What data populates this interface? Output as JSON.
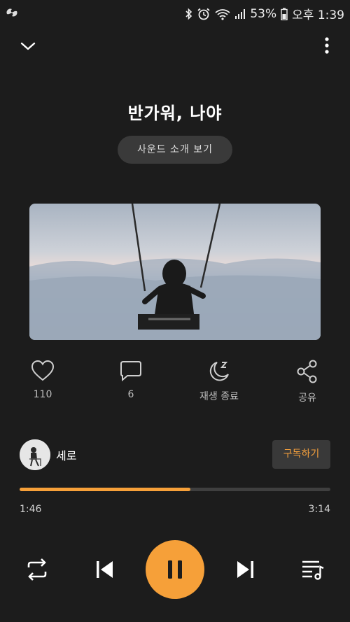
{
  "status": {
    "battery": "53%",
    "time": "오후 1:39"
  },
  "track": {
    "title": "반가워, 나야",
    "intro_label": "사운드 소개 보기"
  },
  "actions": {
    "like_count": "110",
    "comment_count": "6",
    "sleep_label": "재생 종료",
    "share_label": "공유"
  },
  "artist": {
    "name": "세로",
    "subscribe_label": "구독하기"
  },
  "player": {
    "progress_fraction": 0.55,
    "elapsed": "1:46",
    "duration": "3:14"
  },
  "colors": {
    "accent": "#f6a039",
    "background": "#1c1c1c"
  },
  "icons": [
    "chevron-down-icon",
    "more-vertical-icon",
    "heart-icon",
    "comment-icon",
    "moon-sleep-icon",
    "share-icon",
    "repeat-icon",
    "skip-previous-icon",
    "pause-icon",
    "skip-next-icon",
    "playlist-icon"
  ]
}
